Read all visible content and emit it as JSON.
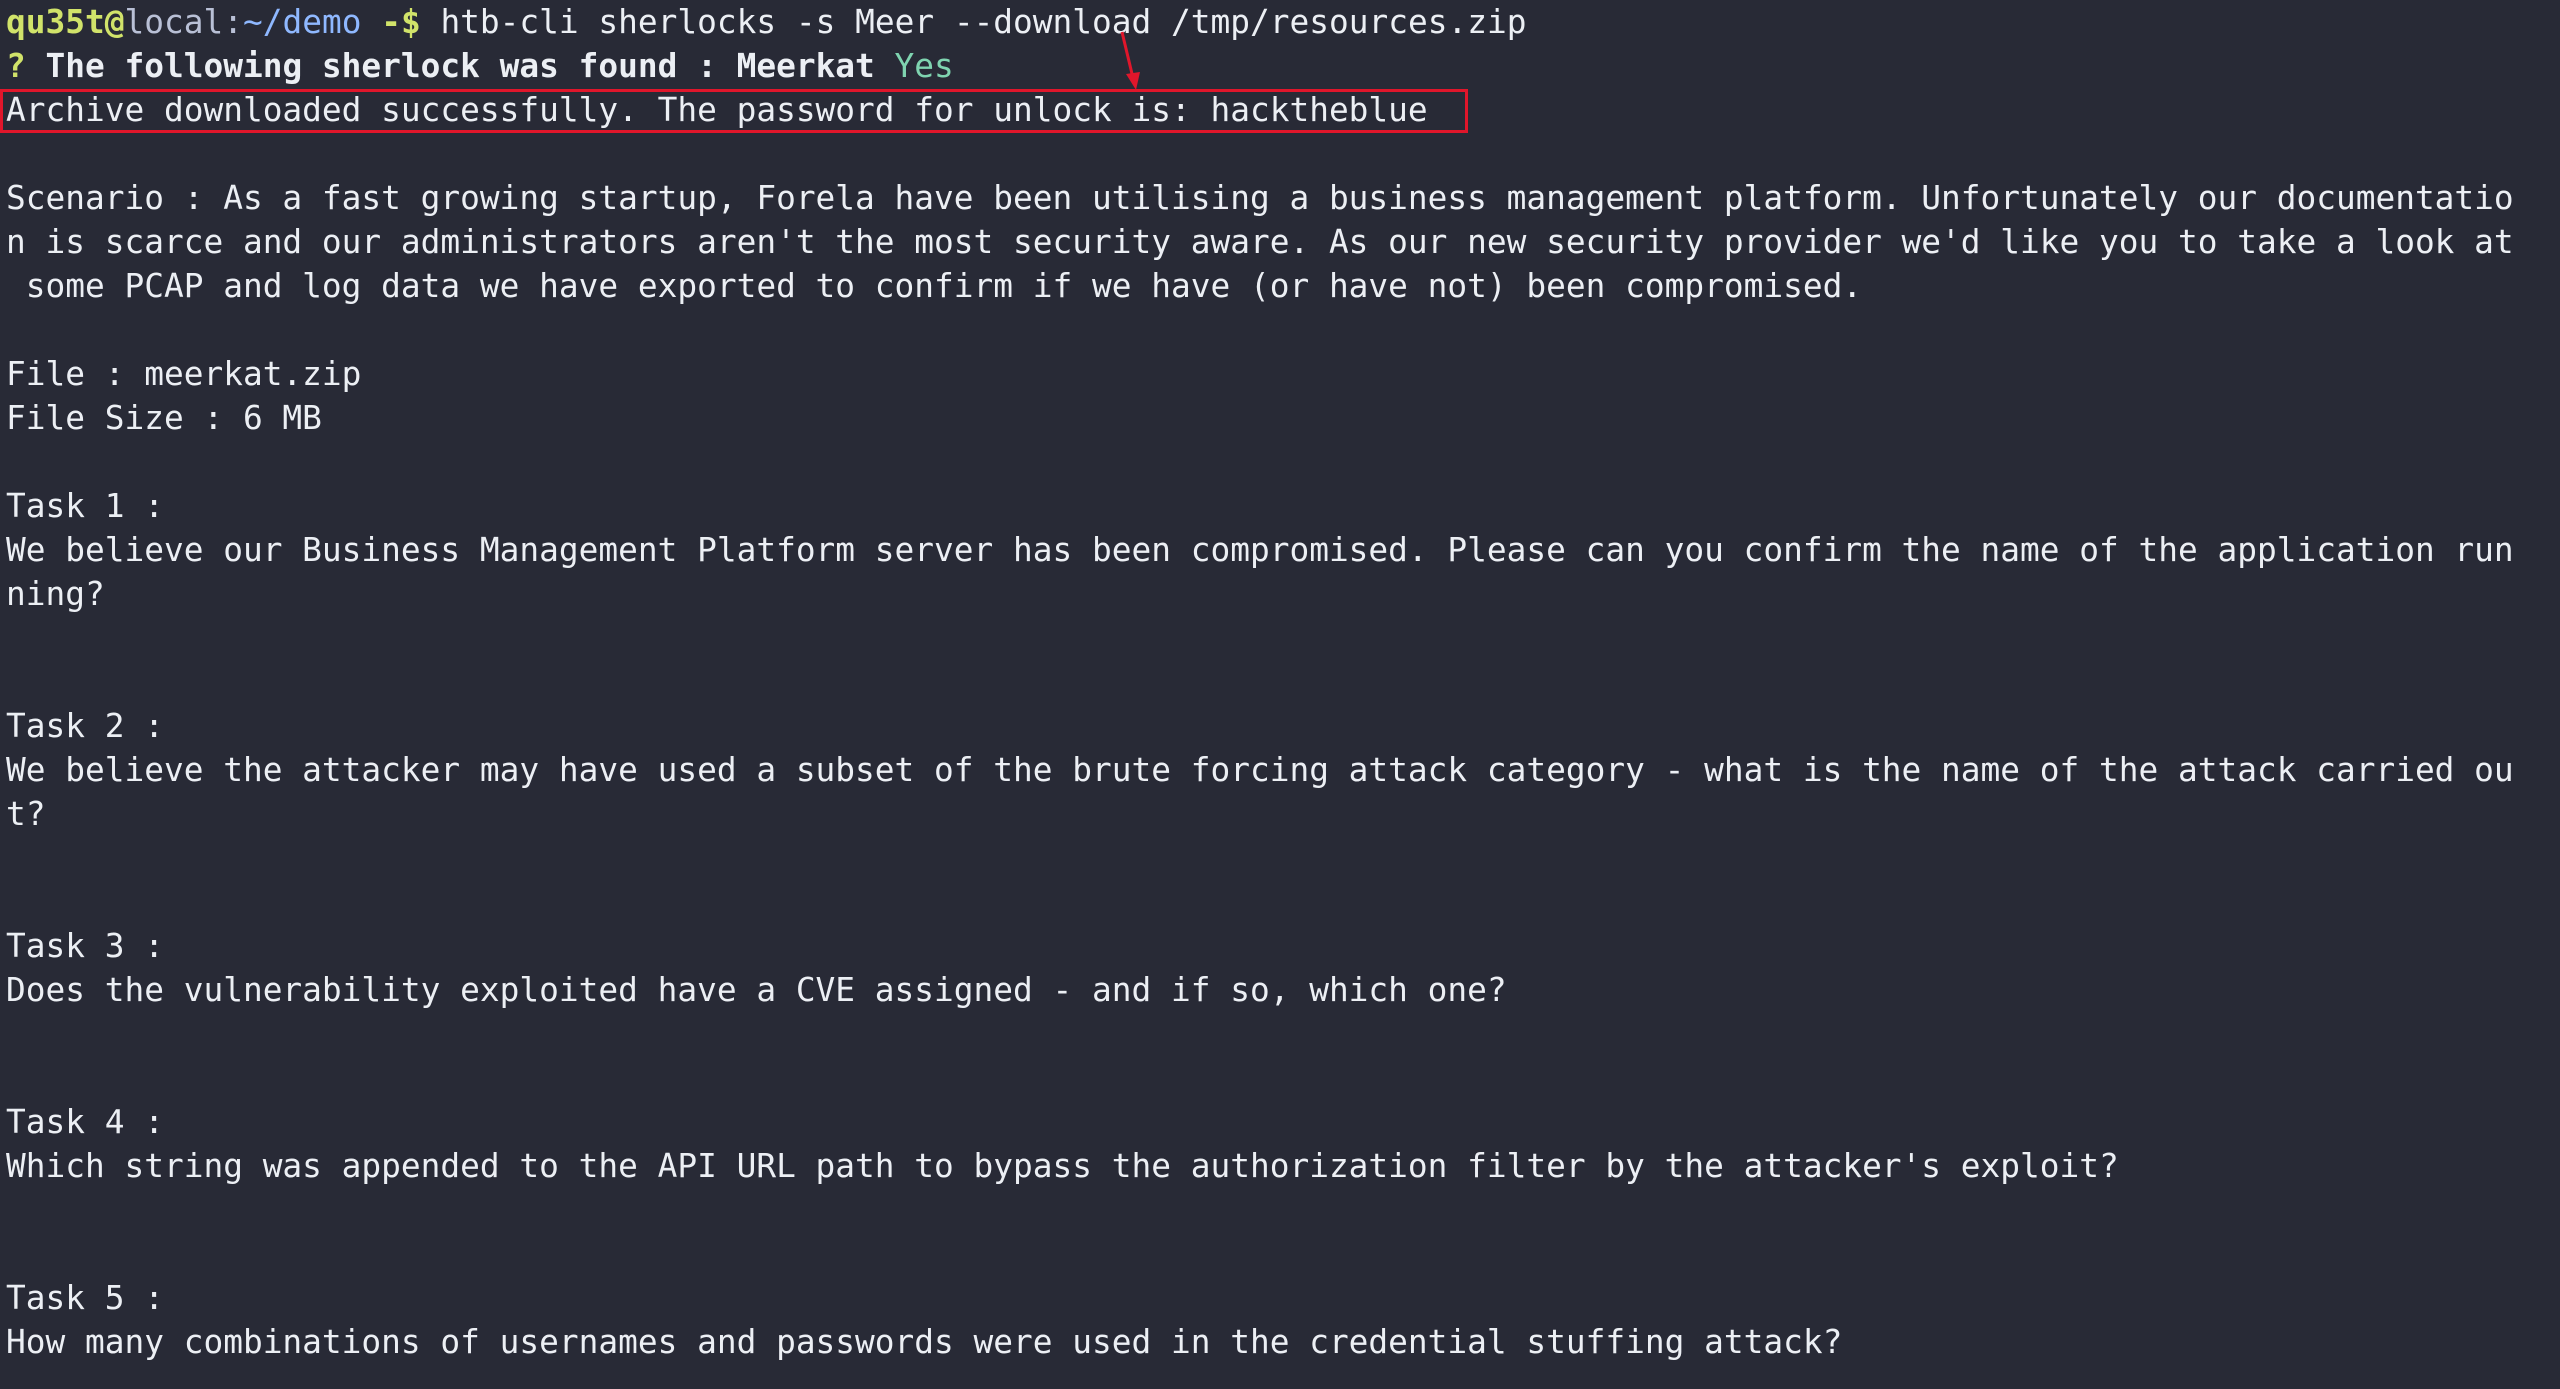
{
  "prompt": {
    "user": "qu35t",
    "at": "@",
    "host": "local",
    "colon": ":",
    "path": "~/demo",
    "symbol": " -$ ",
    "command": "htb-cli sherlocks -s Meer --download /tmp/resources.zip"
  },
  "found": {
    "mark": "?",
    "text": " The following sherlock was found : Meerkat",
    "answer": " Yes"
  },
  "download_message": "Archive downloaded successfully. The password for unlock is: hacktheblue",
  "scenario": [
    "Scenario : As a fast growing startup, Forela have been utilising a business management platform. Unfortunately our documentatio",
    "n is scarce and our administrators aren't the most security aware. As our new security provider we'd like you to take a look at",
    " some PCAP and log data we have exported to confirm if we have (or have not) been compromised."
  ],
  "file": {
    "name_line": "File : meerkat.zip",
    "size_line": "File Size : 6 MB"
  },
  "tasks": [
    {
      "label": "Task 1 :",
      "question": [
        "We believe our Business Management Platform server has been compromised. Please can you confirm the name of the application run",
        "ning?"
      ]
    },
    {
      "label": "Task 2 :",
      "question": [
        "We believe the attacker may have used a subset of the brute forcing attack category - what is the name of the attack carried ou",
        "t?"
      ]
    },
    {
      "label": "Task 3 :",
      "question": [
        "Does the vulnerability exploited have a CVE assigned - and if so, which one?"
      ]
    },
    {
      "label": "Task 4 :",
      "question": [
        "Which string was appended to the API URL path to bypass the authorization filter by the attacker's exploit?"
      ]
    },
    {
      "label": "Task 5 :",
      "question": [
        "How many combinations of usernames and passwords were used in the credential stuffing attack?"
      ]
    }
  ],
  "colors": {
    "background": "#282a36",
    "foreground": "#eceff4",
    "prompt_user": "#d1e36a",
    "prompt_path": "#8fb8ff",
    "yes": "#7fd4b0",
    "annotation": "#e0162b"
  },
  "icons": {
    "annotation": "arrow-icon"
  }
}
